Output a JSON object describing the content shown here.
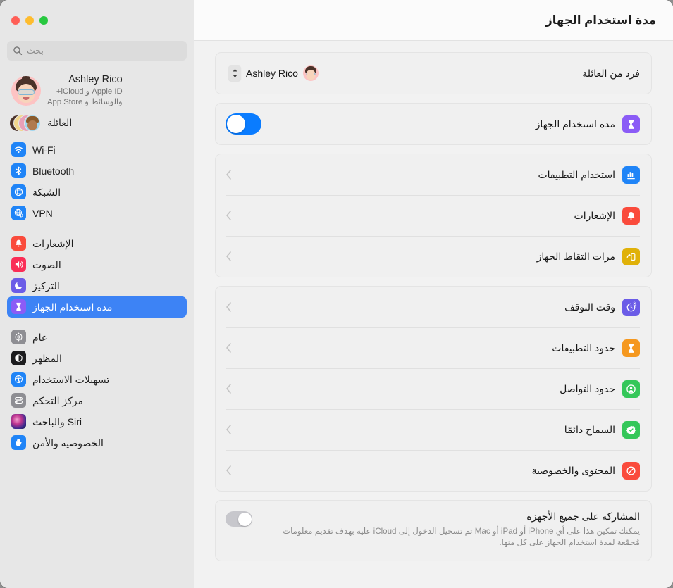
{
  "window": {
    "traffic_lights": [
      {
        "name": "close-button",
        "color": "#ff5f57"
      },
      {
        "name": "minimize-button",
        "color": "#febc2e"
      },
      {
        "name": "maximize-button",
        "color": "#28c840"
      }
    ]
  },
  "sidebar": {
    "search": {
      "placeholder": "بحث",
      "value": ""
    },
    "account": {
      "name": "Ashley Rico",
      "subtitle_line1": "Apple ID و iCloud+",
      "subtitle_line2": "والوسائط و App Store"
    },
    "family": {
      "label": "العائلة"
    },
    "groups": [
      {
        "items": [
          {
            "label": "Wi-Fi",
            "icon": "wifi-icon",
            "color": "#1f84f7",
            "selected": false
          },
          {
            "label": "Bluetooth",
            "icon": "bluetooth-icon",
            "color": "#1f84f7",
            "selected": false
          },
          {
            "label": "الشبكة",
            "icon": "network-icon",
            "color": "#1f84f7",
            "selected": false
          },
          {
            "label": "VPN",
            "icon": "vpn-icon",
            "color": "#1f84f7",
            "selected": false
          }
        ]
      },
      {
        "items": [
          {
            "label": "الإشعارات",
            "icon": "notifications-icon",
            "color": "#fa4b3c",
            "selected": false
          },
          {
            "label": "الصوت",
            "icon": "sound-icon",
            "color": "#fa2e56",
            "selected": false
          },
          {
            "label": "التركيز",
            "icon": "focus-icon",
            "color": "#6b5ce7",
            "selected": false
          },
          {
            "label": "مدة استخدام الجهاز",
            "icon": "screen-time-icon",
            "color": "#8b5cf6",
            "selected": true
          }
        ]
      },
      {
        "items": [
          {
            "label": "عام",
            "icon": "gear-icon",
            "color": "#8e8e93",
            "selected": false
          },
          {
            "label": "المظهر",
            "icon": "appearance-icon",
            "color": "#1c1c1e",
            "selected": false
          },
          {
            "label": "تسهيلات الاستخدام",
            "icon": "accessibility-icon",
            "color": "#1f84f7",
            "selected": false
          },
          {
            "label": "مركز التحكم",
            "icon": "control-center-icon",
            "color": "#8e8e93",
            "selected": false
          },
          {
            "label": "Siri والباحث",
            "icon": "siri-icon",
            "color": "#2b2b3a",
            "selected": false
          },
          {
            "label": "الخصوصية والأمن",
            "icon": "privacy-icon",
            "color": "#1f84f7",
            "selected": false
          }
        ]
      }
    ]
  },
  "main": {
    "title": "مدة استخدام الجهاز",
    "family_member_row": {
      "label": "فرد من العائلة",
      "selected_member": "Ashley Rico"
    },
    "screen_time_row": {
      "label": "مدة استخدام الجهاز",
      "icon": "screen-time-icon",
      "color": "#8b5cf6",
      "enabled": true
    },
    "usage_group": [
      {
        "label": "استخدام التطبيقات",
        "icon": "app-usage-icon",
        "color": "#1f84f7"
      },
      {
        "label": "الإشعارات",
        "icon": "notifications-icon",
        "color": "#fa4b3c"
      },
      {
        "label": "مرات التقاط الجهاز",
        "icon": "pickups-icon",
        "color": "#e0b109"
      }
    ],
    "limits_group": [
      {
        "label": "وقت التوقف",
        "icon": "downtime-icon",
        "color": "#6b5ce7"
      },
      {
        "label": "حدود التطبيقات",
        "icon": "app-limits-icon",
        "color": "#f5981f"
      },
      {
        "label": "حدود التواصل",
        "icon": "communication-icon",
        "color": "#34c759"
      },
      {
        "label": "السماح دائمًا",
        "icon": "always-allowed-icon",
        "color": "#34c759"
      },
      {
        "label": "المحتوى والخصوصية",
        "icon": "content-privacy-icon",
        "color": "#fa4b3c"
      }
    ],
    "share_row": {
      "title": "المشاركة على جميع الأجهزة",
      "description": "يمكنك تمكين هذا على أي iPhone أو iPad أو Mac تم تسجيل الدخول إلى iCloud عليه بهدف تقديم معلومات مُجمّعة لمدة استخدام الجهاز على كل منها.",
      "enabled": false
    }
  },
  "colors": {
    "accent": "#3d83f5",
    "toggle_on": "#0a7cff",
    "toggle_off": "#c7c7cc",
    "sidebar_bg": "#e7e7e7",
    "main_bg": "#f2f2f2",
    "card_bg": "#f0f0f0"
  }
}
